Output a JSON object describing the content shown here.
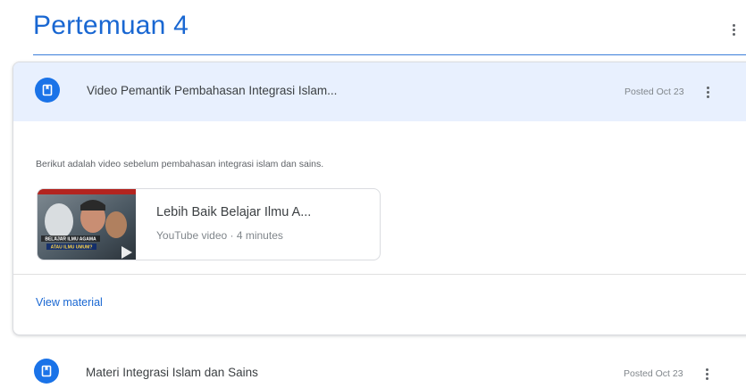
{
  "topic": {
    "title": "Pertemuan 4"
  },
  "materials": [
    {
      "title": "Video Pemantik Pembahasan Integrasi Islam...",
      "posted": "Posted Oct 23",
      "description": "Berikut adalah video sebelum pembahasan integrasi islam dan sains.",
      "attachment": {
        "title": "Lebih Baik Belajar Ilmu A...",
        "subtitle": "YouTube video · 4 minutes",
        "thumbnail_text_1": "BELAJAR ILMU AGAMA",
        "thumbnail_text_2": "ATAU ILMU UMUM?"
      },
      "view_link": "View material"
    },
    {
      "title": "Materi Integrasi Islam dan Sains",
      "posted": "Posted Oct 23"
    }
  ],
  "icons": {
    "material": "bookmark-icon",
    "more": "more-vert-icon",
    "play": "play-icon"
  },
  "colors": {
    "accent": "#1967d2",
    "icon_bg": "#1a73e8",
    "header_bg": "#e8f0fe"
  }
}
